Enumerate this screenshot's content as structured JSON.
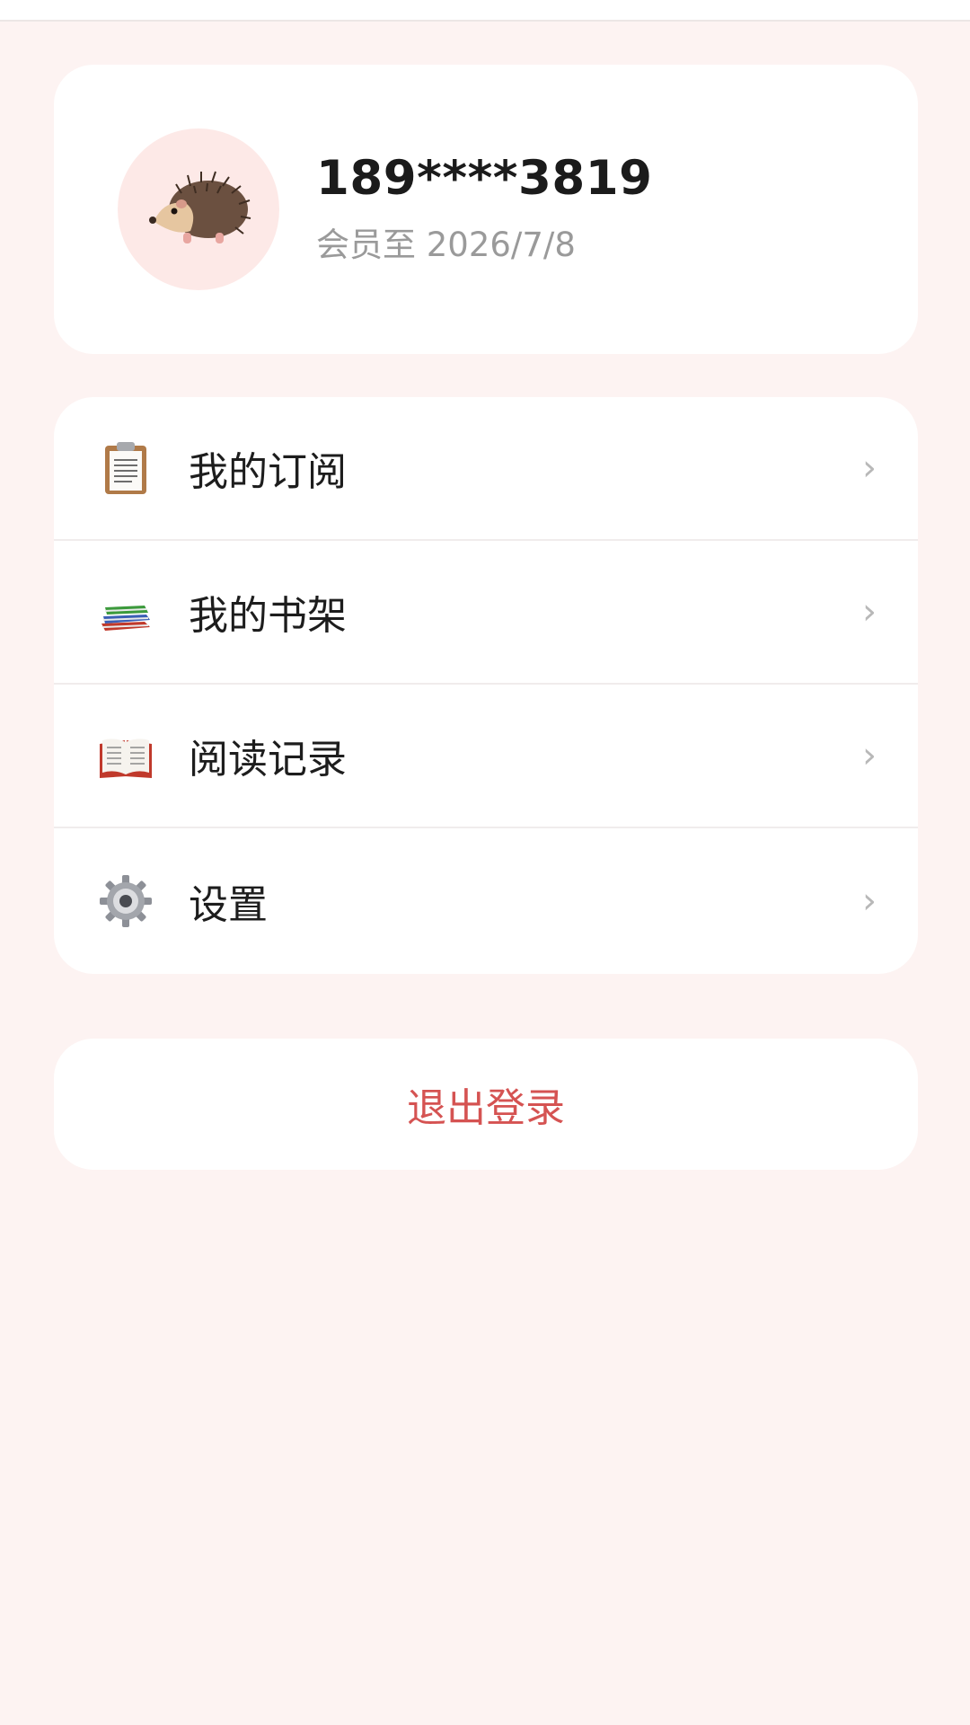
{
  "profile": {
    "avatar_icon": "hedgehog-icon",
    "phone": "189****3819",
    "membership": "会员至 2026/7/8"
  },
  "menu": {
    "items": [
      {
        "icon": "clipboard-icon",
        "label": "我的订阅"
      },
      {
        "icon": "books-icon",
        "label": "我的书架"
      },
      {
        "icon": "open-book-icon",
        "label": "阅读记录"
      },
      {
        "icon": "gear-icon",
        "label": "设置"
      }
    ],
    "chevron": "›"
  },
  "logout": {
    "label": "退出登录"
  },
  "colors": {
    "background": "#fdf3f2",
    "card": "#ffffff",
    "logout_text": "#d55352",
    "avatar_bg": "#fde9e7"
  }
}
